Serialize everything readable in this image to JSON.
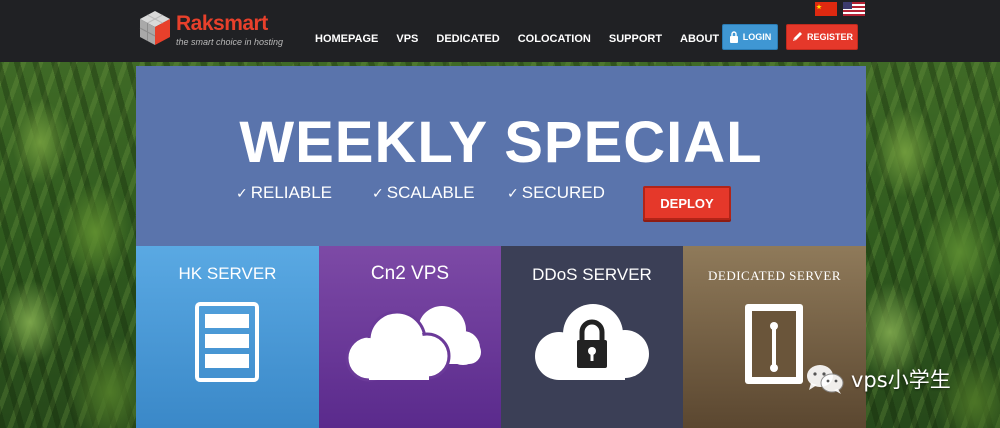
{
  "brand": {
    "name": "Raksmart",
    "tagline": "the smart choice in hosting",
    "accent_color": "#e8402b"
  },
  "nav": {
    "items": [
      {
        "label": "HOMEPAGE"
      },
      {
        "label": "VPS"
      },
      {
        "label": "DEDICATED"
      },
      {
        "label": "COLOCATION"
      },
      {
        "label": "SUPPORT"
      },
      {
        "label": "ABOUT"
      }
    ],
    "login_label": "LOGIN",
    "register_label": "REGISTER",
    "flags": [
      "china-flag-icon",
      "us-flag-icon"
    ]
  },
  "hero": {
    "title": "WEEKLY SPECIAL",
    "features": [
      "RELIABLE",
      "SCALABLE",
      "SECURED"
    ],
    "deploy_label": "DEPLOY",
    "background_color": "#5a74ac"
  },
  "tiles": [
    {
      "title": "HK SERVER",
      "icon": "server-rack-icon",
      "color": "#4a98d6"
    },
    {
      "title": "Cn2 VPS",
      "icon": "cloud-icon",
      "color": "#6b3a99"
    },
    {
      "title": "DDoS SERVER",
      "icon": "cloud-lock-icon",
      "color": "#3b3f56"
    },
    {
      "title": "DEDICATED SERVER",
      "icon": "dedicated-server-icon",
      "color": "#7a6445"
    }
  ],
  "watermark": {
    "text": "vps小学生",
    "icon": "wechat-icon"
  }
}
